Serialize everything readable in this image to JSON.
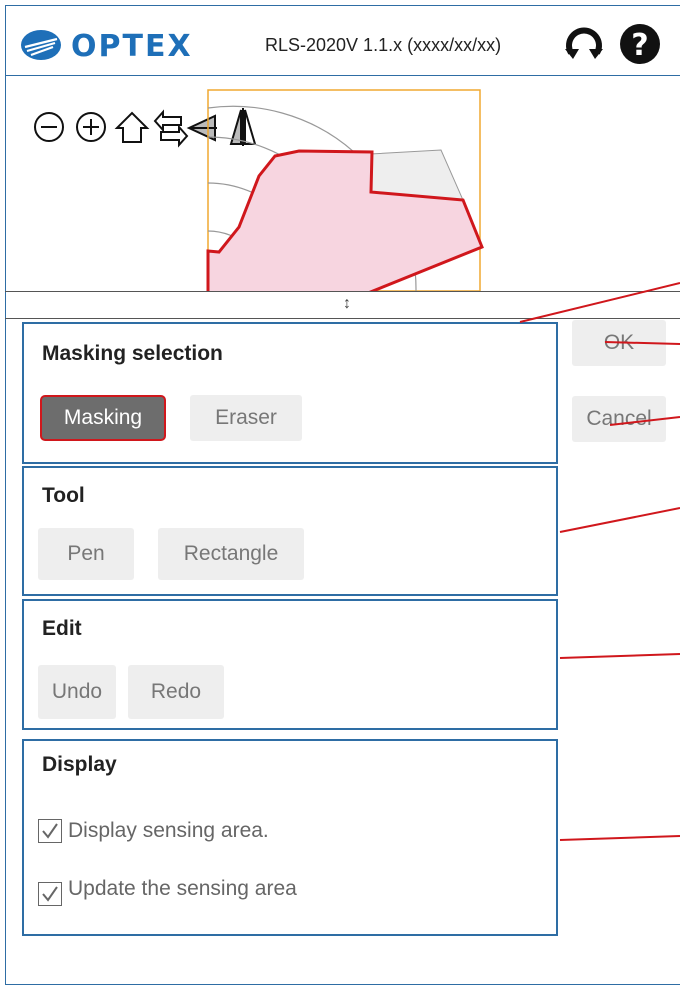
{
  "header": {
    "logo_text": "OPTEX",
    "version": "RLS-2020V 1.1.x (xxxx/xx/xx)",
    "icons": [
      "rotate-icon",
      "help-icon"
    ]
  },
  "toolbar": {
    "icons": [
      "zoom-out-icon",
      "zoom-in-icon",
      "home-icon",
      "swap-icon",
      "flip-horizontal-icon",
      "flip-vertical-icon"
    ]
  },
  "dialog": {
    "ok_label": "OK",
    "cancel_label": "Cancel"
  },
  "masking_selection": {
    "title": "Masking selection",
    "masking_label": "Masking",
    "eraser_label": "Eraser",
    "selected": "Masking"
  },
  "tool": {
    "title": "Tool",
    "pen_label": "Pen",
    "rectangle_label": "Rectangle"
  },
  "edit": {
    "title": "Edit",
    "undo_label": "Undo",
    "redo_label": "Redo"
  },
  "display": {
    "title": "Display",
    "option1_label": "Display sensing area.",
    "option1_checked": true,
    "option2_label": "Update the sensing area",
    "option2_checked": true
  },
  "colors": {
    "frame": "#2e6da4",
    "mask_outline": "#d0171c",
    "mask_fill": "#f7d5e0",
    "viewport_border": "#f0a830"
  }
}
